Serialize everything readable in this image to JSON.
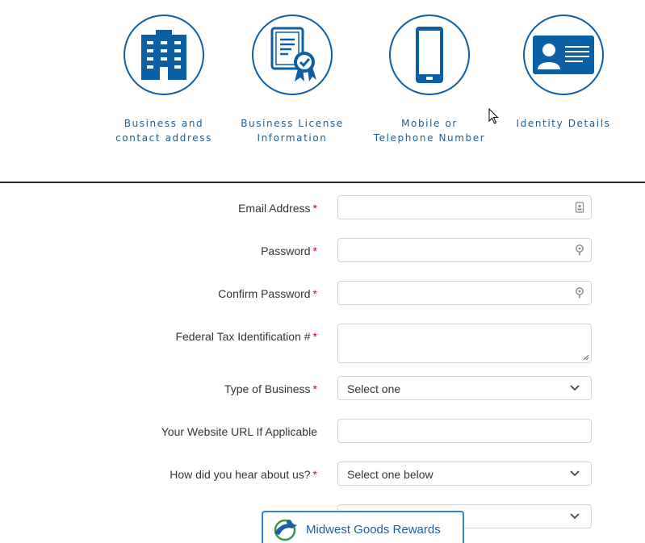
{
  "steps": [
    {
      "icon": "building-icon",
      "line1": "Business and",
      "line2": "contact address"
    },
    {
      "icon": "certificate-icon",
      "line1": "Business License",
      "line2": "Information"
    },
    {
      "icon": "mobile-phone-icon",
      "line1": "Mobile or",
      "line2": "Telephone Number"
    },
    {
      "icon": "id-card-icon",
      "line1": "Identity Details",
      "line2": ""
    }
  ],
  "form": {
    "email": {
      "label": "Email Address",
      "required": "*",
      "value": ""
    },
    "password": {
      "label": "Password",
      "required": "*",
      "value": ""
    },
    "confirm_password": {
      "label": "Confirm Password",
      "required": "*",
      "value": ""
    },
    "federal_tax_id": {
      "label": "Federal Tax Identification #",
      "required": "*",
      "value": ""
    },
    "type_of_business": {
      "label": "Type of Business",
      "required": "*",
      "selected": "Select one"
    },
    "website_url": {
      "label": "Your Website URL If Applicable",
      "value": ""
    },
    "heard_about": {
      "label": "How did you hear about us?",
      "required": "*",
      "selected": "Select one below"
    }
  },
  "rewards_widget": {
    "label": "Midwest Goods Rewards"
  },
  "colors": {
    "accent": "#0b5fa5",
    "required": "#d0021b",
    "label_text": "#1c5d8f",
    "widget_border": "#2f86c8"
  }
}
